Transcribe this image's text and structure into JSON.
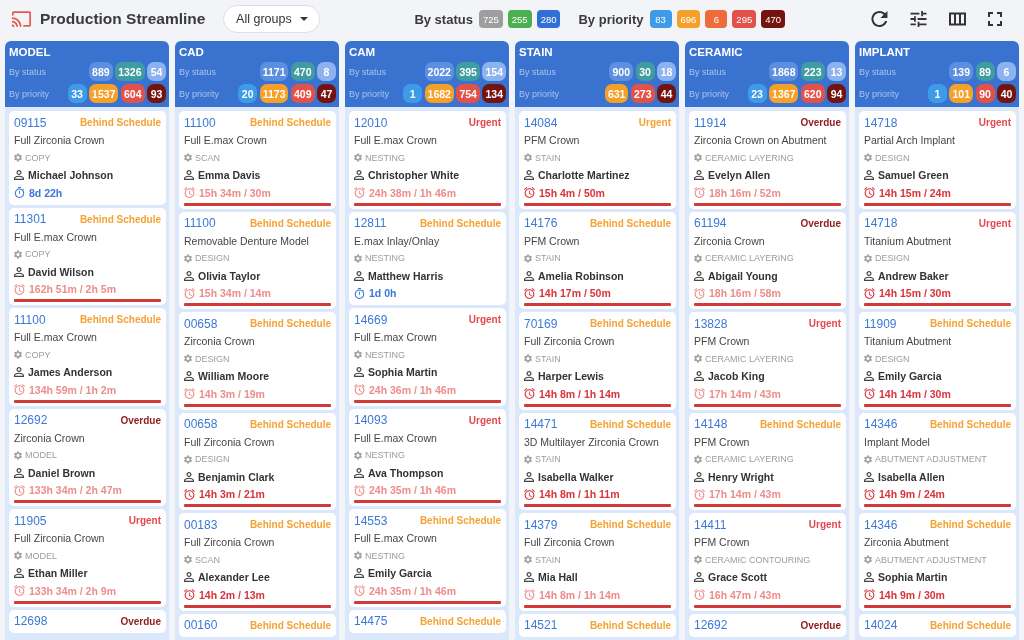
{
  "app": {
    "title": "Production Streamline",
    "group_filter": {
      "value": "All groups"
    }
  },
  "summary": {
    "status_label": "By status",
    "status_counts": [
      {
        "value": "725",
        "color": "#9e9e9e"
      },
      {
        "value": "255",
        "color": "#4caf50"
      },
      {
        "value": "280",
        "color": "#2f6fd6"
      }
    ],
    "priority_label": "By priority",
    "priority_counts": [
      {
        "value": "83",
        "color": "#3d9be9"
      },
      {
        "value": "696",
        "color": "#f5a028"
      },
      {
        "value": "6",
        "color": "#ee6b3b"
      },
      {
        "value": "295",
        "color": "#e2524a"
      },
      {
        "value": "470",
        "color": "#741410"
      }
    ]
  },
  "columns": [
    {
      "title": "MODEL",
      "status_label": "By status",
      "status_counts": [
        {
          "value": "889",
          "color": "#5d8fe0"
        },
        {
          "value": "1326",
          "color": "#3f9ca0"
        },
        {
          "value": "54",
          "color": "#8db2f0"
        }
      ],
      "priority_label": "By priority",
      "priority_counts": [
        {
          "value": "33",
          "color": "#3d9be9"
        },
        {
          "value": "1537",
          "color": "#f5a028"
        },
        {
          "value": "604",
          "color": "#e2524a"
        },
        {
          "value": "93",
          "color": "#741410"
        }
      ],
      "cards": [
        {
          "id": "09115",
          "status": "Behind Schedule",
          "color": "#f5a233",
          "product": "Full Zirconia Crown",
          "stage": "COPY",
          "assignee": "Michael Johnson",
          "time": {
            "kind": "timer",
            "text": "8d 22h",
            "dimmed": false
          }
        },
        {
          "id": "11301",
          "status": "Behind Schedule",
          "color": "#f5a233",
          "product": "Full E.max Crown",
          "stage": "COPY",
          "assignee": "David Wilson",
          "time": {
            "kind": "overtime",
            "text": "162h 51m / 2h 5m",
            "dimmed": true
          }
        },
        {
          "id": "11100",
          "status": "Behind Schedule",
          "color": "#f5a233",
          "product": "Full E.max Crown",
          "stage": "COPY",
          "assignee": "James Anderson",
          "time": {
            "kind": "overtime",
            "text": "134h 59m / 1h 2m",
            "dimmed": true
          }
        },
        {
          "id": "12692",
          "status": "Overdue",
          "color": "#8e1c1c",
          "product": "Zirconia Crown",
          "stage": "MODEL",
          "assignee": "Daniel Brown",
          "time": {
            "kind": "overtime",
            "text": "133h 34m / 2h 47m",
            "dimmed": true
          }
        },
        {
          "id": "11905",
          "status": "Urgent",
          "color": "#e5484d",
          "product": "Full Zirconia Crown",
          "stage": "MODEL",
          "assignee": "Ethan Miller",
          "time": {
            "kind": "overtime",
            "text": "133h 34m / 2h 9m",
            "dimmed": true
          }
        },
        {
          "id": "12698",
          "status": "Overdue",
          "color": "#8e1c1c"
        }
      ]
    },
    {
      "title": "CAD",
      "status_label": "By status",
      "status_counts": [
        {
          "value": "1171",
          "color": "#5d8fe0"
        },
        {
          "value": "470",
          "color": "#3f9ca0"
        },
        {
          "value": "8",
          "color": "#8db2f0"
        }
      ],
      "priority_label": "By priority",
      "priority_counts": [
        {
          "value": "20",
          "color": "#3d9be9"
        },
        {
          "value": "1173",
          "color": "#f5a028"
        },
        {
          "value": "409",
          "color": "#e2524a"
        },
        {
          "value": "47",
          "color": "#741410"
        }
      ],
      "cards": [
        {
          "id": "11100",
          "status": "Behind Schedule",
          "color": "#f5a233",
          "product": "Full E.max Crown",
          "stage": "SCAN",
          "assignee": "Emma Davis",
          "time": {
            "kind": "overtime",
            "text": "15h 34m / 30m",
            "dimmed": true
          }
        },
        {
          "id": "11100",
          "status": "Behind Schedule",
          "color": "#f5a233",
          "product": "Removable Denture Model",
          "stage": "DESIGN",
          "assignee": "Olivia Taylor",
          "time": {
            "kind": "overtime",
            "text": "15h 34m / 14m",
            "dimmed": true
          }
        },
        {
          "id": "00658",
          "status": "Behind Schedule",
          "color": "#f5a233",
          "product": "Zirconia Crown",
          "stage": "DESIGN",
          "assignee": "William Moore",
          "time": {
            "kind": "overtime",
            "text": "14h 3m / 19m",
            "dimmed": true
          }
        },
        {
          "id": "00658",
          "status": "Behind Schedule",
          "color": "#f5a233",
          "product": "Full Zirconia Crown",
          "stage": "DESIGN",
          "assignee": "Benjamin Clark",
          "time": {
            "kind": "overtime",
            "text": "14h 3m / 21m",
            "dimmed": false
          }
        },
        {
          "id": "00183",
          "status": "Behind Schedule",
          "color": "#f5a233",
          "product": "Full Zirconia Crown",
          "stage": "SCAN",
          "assignee": "Alexander Lee",
          "time": {
            "kind": "overtime",
            "text": "14h 2m / 13m",
            "dimmed": false
          }
        },
        {
          "id": "00160",
          "status": "Behind Schedule",
          "color": "#f5a233"
        }
      ]
    },
    {
      "title": "CAM",
      "status_label": "By status",
      "status_counts": [
        {
          "value": "2022",
          "color": "#5d8fe0"
        },
        {
          "value": "395",
          "color": "#3f9ca0"
        },
        {
          "value": "154",
          "color": "#8db2f0"
        }
      ],
      "priority_label": "By priority",
      "priority_counts": [
        {
          "value": "1",
          "color": "#3d9be9"
        },
        {
          "value": "1682",
          "color": "#f5a028"
        },
        {
          "value": "754",
          "color": "#e2524a"
        },
        {
          "value": "134",
          "color": "#741410"
        }
      ],
      "cards": [
        {
          "id": "12010",
          "status": "Urgent",
          "color": "#e5484d",
          "product": "Full E.max Crown",
          "stage": "NESTING",
          "assignee": "Christopher White",
          "time": {
            "kind": "overtime",
            "text": "24h 38m / 1h 46m",
            "dimmed": true
          }
        },
        {
          "id": "12811",
          "status": "Behind Schedule",
          "color": "#f5a233",
          "product": "E.max Inlay/Onlay",
          "stage": "NESTING",
          "assignee": "Matthew Harris",
          "time": {
            "kind": "timer",
            "text": "1d 0h",
            "dimmed": false
          }
        },
        {
          "id": "14669",
          "status": "Urgent",
          "color": "#e5484d",
          "product": "Full E.max Crown",
          "stage": "NESTING",
          "assignee": "Sophia Martin",
          "time": {
            "kind": "overtime",
            "text": "24h 36m / 1h 46m",
            "dimmed": true
          }
        },
        {
          "id": "14093",
          "status": "Urgent",
          "color": "#e5484d",
          "product": "Full E.max Crown",
          "stage": "NESTING",
          "assignee": "Ava Thompson",
          "time": {
            "kind": "overtime",
            "text": "24h 35m / 1h 46m",
            "dimmed": true
          }
        },
        {
          "id": "14553",
          "status": "Behind Schedule",
          "color": "#f5a233",
          "product": "Full E.max Crown",
          "stage": "NESTING",
          "assignee": "Emily Garcia",
          "time": {
            "kind": "overtime",
            "text": "24h 35m / 1h 46m",
            "dimmed": true
          }
        },
        {
          "id": "14475",
          "status": "Behind Schedule",
          "color": "#f5a233"
        }
      ]
    },
    {
      "title": "STAIN",
      "status_label": "By status",
      "status_counts": [
        {
          "value": "900",
          "color": "#5d8fe0"
        },
        {
          "value": "30",
          "color": "#3f9ca0"
        },
        {
          "value": "18",
          "color": "#8db2f0"
        }
      ],
      "priority_label": "By priority",
      "priority_counts": [
        {
          "value": "631",
          "color": "#f5a028"
        },
        {
          "value": "273",
          "color": "#e2524a"
        },
        {
          "value": "44",
          "color": "#741410"
        }
      ],
      "cards": [
        {
          "id": "14084",
          "status": "Urgent",
          "color": "#f5a233",
          "product": "PFM Crown",
          "stage": "STAIN",
          "assignee": "Charlotte Martinez",
          "time": {
            "kind": "overtime",
            "text": "15h 4m / 50m",
            "dimmed": false
          }
        },
        {
          "id": "14176",
          "status": "Behind Schedule",
          "color": "#f5a233",
          "product": "PFM Crown",
          "stage": "STAIN",
          "assignee": "Amelia Robinson",
          "time": {
            "kind": "overtime",
            "text": "14h 17m / 50m",
            "dimmed": false
          }
        },
        {
          "id": "70169",
          "status": "Behind Schedule",
          "color": "#f5a233",
          "product": "Full Zirconia Crown",
          "stage": "STAIN",
          "assignee": "Harper Lewis",
          "time": {
            "kind": "overtime",
            "text": "14h 8m / 1h 14m",
            "dimmed": false
          }
        },
        {
          "id": "14471",
          "status": "Behind Schedule",
          "color": "#f5a233",
          "product": "3D Multilayer Zirconia Crown",
          "stage": "STAIN",
          "assignee": "Isabella Walker",
          "time": {
            "kind": "overtime",
            "text": "14h 8m / 1h 11m",
            "dimmed": false
          }
        },
        {
          "id": "14379",
          "status": "Behind Schedule",
          "color": "#f5a233",
          "product": "Full Zirconia Crown",
          "stage": "STAIN",
          "assignee": "Mia Hall",
          "time": {
            "kind": "overtime",
            "text": "14h 8m / 1h 14m",
            "dimmed": true
          }
        },
        {
          "id": "14521",
          "status": "Behind Schedule",
          "color": "#f5a233"
        }
      ]
    },
    {
      "title": "CERAMIC",
      "status_label": "By status",
      "status_counts": [
        {
          "value": "1868",
          "color": "#5d8fe0"
        },
        {
          "value": "223",
          "color": "#3f9ca0"
        },
        {
          "value": "13",
          "color": "#8db2f0"
        }
      ],
      "priority_label": "By priority",
      "priority_counts": [
        {
          "value": "23",
          "color": "#3d9be9"
        },
        {
          "value": "1367",
          "color": "#f5a028"
        },
        {
          "value": "620",
          "color": "#e2524a"
        },
        {
          "value": "94",
          "color": "#741410"
        }
      ],
      "cards": [
        {
          "id": "11914",
          "status": "Overdue",
          "color": "#8e1c1c",
          "product": "Zirconia Crown on Abutment",
          "stage": "CERAMIC LAYERING",
          "assignee": "Evelyn Allen",
          "time": {
            "kind": "overtime",
            "text": "18h 16m / 52m",
            "dimmed": true
          }
        },
        {
          "id": "61194",
          "status": "Overdue",
          "color": "#8e1c1c",
          "product": "Zirconia Crown",
          "stage": "CERAMIC LAYERING",
          "assignee": "Abigail Young",
          "time": {
            "kind": "overtime",
            "text": "18h 16m / 58m",
            "dimmed": true
          }
        },
        {
          "id": "13828",
          "status": "Urgent",
          "color": "#e5484d",
          "product": "PFM Crown",
          "stage": "CERAMIC LAYERING",
          "assignee": "Jacob King",
          "time": {
            "kind": "overtime",
            "text": "17h 14m / 43m",
            "dimmed": true
          }
        },
        {
          "id": "14148",
          "status": "Behind Schedule",
          "color": "#f5a233",
          "product": "PFM Crown",
          "stage": "CERAMIC LAYERING",
          "assignee": "Henry Wright",
          "time": {
            "kind": "overtime",
            "text": "17h 14m / 43m",
            "dimmed": true
          }
        },
        {
          "id": "14411",
          "status": "Urgent",
          "color": "#e5484d",
          "product": "PFM Crown",
          "stage": "CERAMIC CONTOURING",
          "assignee": "Grace Scott",
          "time": {
            "kind": "overtime",
            "text": "16h 47m / 43m",
            "dimmed": true
          }
        },
        {
          "id": "12692",
          "status": "Overdue",
          "color": "#8e1c1c"
        }
      ]
    },
    {
      "title": "IMPLANT",
      "status_label": "By status",
      "status_counts": [
        {
          "value": "139",
          "color": "#5d8fe0"
        },
        {
          "value": "89",
          "color": "#3f9ca0"
        },
        {
          "value": "6",
          "color": "#8db2f0"
        }
      ],
      "priority_label": "By priority",
      "priority_counts": [
        {
          "value": "1",
          "color": "#3d9be9"
        },
        {
          "value": "101",
          "color": "#f5a028"
        },
        {
          "value": "90",
          "color": "#e2524a"
        },
        {
          "value": "40",
          "color": "#741410"
        }
      ],
      "cards": [
        {
          "id": "14718",
          "status": "Urgent",
          "color": "#e5484d",
          "product": "Partial Arch Implant",
          "stage": "DESIGN",
          "assignee": "Samuel Green",
          "time": {
            "kind": "overtime",
            "text": "14h 15m / 24m",
            "dimmed": false
          }
        },
        {
          "id": "14718",
          "status": "Urgent",
          "color": "#e5484d",
          "product": "Titanium Abutment",
          "stage": "DESIGN",
          "assignee": "Andrew Baker",
          "time": {
            "kind": "overtime",
            "text": "14h 15m / 30m",
            "dimmed": false
          }
        },
        {
          "id": "11909",
          "status": "Behind Schedule",
          "color": "#f5a233",
          "product": "Titanium Abutment",
          "stage": "DESIGN",
          "assignee": "Emily Garcia",
          "time": {
            "kind": "overtime",
            "text": "14h 14m / 30m",
            "dimmed": false
          }
        },
        {
          "id": "14346",
          "status": "Behind Schedule",
          "color": "#f5a233",
          "product": "Implant Model",
          "stage": "ABUTMENT ADJUSTMENT",
          "assignee": "Isabella Allen",
          "time": {
            "kind": "overtime",
            "text": "14h 9m / 24m",
            "dimmed": false
          }
        },
        {
          "id": "14346",
          "status": "Behind Schedule",
          "color": "#f5a233",
          "product": "Zirconia Abutment",
          "stage": "ABUTMENT ADJUSTMENT",
          "assignee": "Sophia Martin",
          "time": {
            "kind": "overtime",
            "text": "14h 9m / 30m",
            "dimmed": false
          }
        },
        {
          "id": "14024",
          "status": "Behind Schedule",
          "color": "#f5a233"
        }
      ]
    }
  ]
}
